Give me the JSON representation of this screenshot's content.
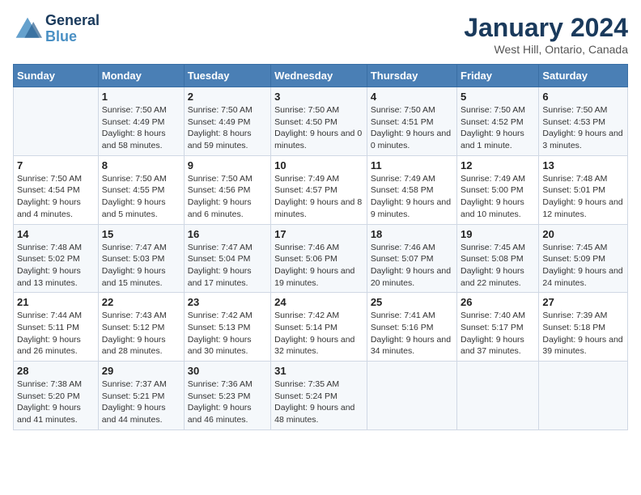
{
  "header": {
    "logo_line1": "General",
    "logo_line2": "Blue",
    "title": "January 2024",
    "subtitle": "West Hill, Ontario, Canada"
  },
  "weekdays": [
    "Sunday",
    "Monday",
    "Tuesday",
    "Wednesday",
    "Thursday",
    "Friday",
    "Saturday"
  ],
  "weeks": [
    [
      {
        "day": "",
        "sunrise": "",
        "sunset": "",
        "daylight": ""
      },
      {
        "day": "1",
        "sunrise": "Sunrise: 7:50 AM",
        "sunset": "Sunset: 4:49 PM",
        "daylight": "Daylight: 8 hours and 58 minutes."
      },
      {
        "day": "2",
        "sunrise": "Sunrise: 7:50 AM",
        "sunset": "Sunset: 4:49 PM",
        "daylight": "Daylight: 8 hours and 59 minutes."
      },
      {
        "day": "3",
        "sunrise": "Sunrise: 7:50 AM",
        "sunset": "Sunset: 4:50 PM",
        "daylight": "Daylight: 9 hours and 0 minutes."
      },
      {
        "day": "4",
        "sunrise": "Sunrise: 7:50 AM",
        "sunset": "Sunset: 4:51 PM",
        "daylight": "Daylight: 9 hours and 0 minutes."
      },
      {
        "day": "5",
        "sunrise": "Sunrise: 7:50 AM",
        "sunset": "Sunset: 4:52 PM",
        "daylight": "Daylight: 9 hours and 1 minute."
      },
      {
        "day": "6",
        "sunrise": "Sunrise: 7:50 AM",
        "sunset": "Sunset: 4:53 PM",
        "daylight": "Daylight: 9 hours and 3 minutes."
      }
    ],
    [
      {
        "day": "7",
        "sunrise": "Sunrise: 7:50 AM",
        "sunset": "Sunset: 4:54 PM",
        "daylight": "Daylight: 9 hours and 4 minutes."
      },
      {
        "day": "8",
        "sunrise": "Sunrise: 7:50 AM",
        "sunset": "Sunset: 4:55 PM",
        "daylight": "Daylight: 9 hours and 5 minutes."
      },
      {
        "day": "9",
        "sunrise": "Sunrise: 7:50 AM",
        "sunset": "Sunset: 4:56 PM",
        "daylight": "Daylight: 9 hours and 6 minutes."
      },
      {
        "day": "10",
        "sunrise": "Sunrise: 7:49 AM",
        "sunset": "Sunset: 4:57 PM",
        "daylight": "Daylight: 9 hours and 8 minutes."
      },
      {
        "day": "11",
        "sunrise": "Sunrise: 7:49 AM",
        "sunset": "Sunset: 4:58 PM",
        "daylight": "Daylight: 9 hours and 9 minutes."
      },
      {
        "day": "12",
        "sunrise": "Sunrise: 7:49 AM",
        "sunset": "Sunset: 5:00 PM",
        "daylight": "Daylight: 9 hours and 10 minutes."
      },
      {
        "day": "13",
        "sunrise": "Sunrise: 7:48 AM",
        "sunset": "Sunset: 5:01 PM",
        "daylight": "Daylight: 9 hours and 12 minutes."
      }
    ],
    [
      {
        "day": "14",
        "sunrise": "Sunrise: 7:48 AM",
        "sunset": "Sunset: 5:02 PM",
        "daylight": "Daylight: 9 hours and 13 minutes."
      },
      {
        "day": "15",
        "sunrise": "Sunrise: 7:47 AM",
        "sunset": "Sunset: 5:03 PM",
        "daylight": "Daylight: 9 hours and 15 minutes."
      },
      {
        "day": "16",
        "sunrise": "Sunrise: 7:47 AM",
        "sunset": "Sunset: 5:04 PM",
        "daylight": "Daylight: 9 hours and 17 minutes."
      },
      {
        "day": "17",
        "sunrise": "Sunrise: 7:46 AM",
        "sunset": "Sunset: 5:06 PM",
        "daylight": "Daylight: 9 hours and 19 minutes."
      },
      {
        "day": "18",
        "sunrise": "Sunrise: 7:46 AM",
        "sunset": "Sunset: 5:07 PM",
        "daylight": "Daylight: 9 hours and 20 minutes."
      },
      {
        "day": "19",
        "sunrise": "Sunrise: 7:45 AM",
        "sunset": "Sunset: 5:08 PM",
        "daylight": "Daylight: 9 hours and 22 minutes."
      },
      {
        "day": "20",
        "sunrise": "Sunrise: 7:45 AM",
        "sunset": "Sunset: 5:09 PM",
        "daylight": "Daylight: 9 hours and 24 minutes."
      }
    ],
    [
      {
        "day": "21",
        "sunrise": "Sunrise: 7:44 AM",
        "sunset": "Sunset: 5:11 PM",
        "daylight": "Daylight: 9 hours and 26 minutes."
      },
      {
        "day": "22",
        "sunrise": "Sunrise: 7:43 AM",
        "sunset": "Sunset: 5:12 PM",
        "daylight": "Daylight: 9 hours and 28 minutes."
      },
      {
        "day": "23",
        "sunrise": "Sunrise: 7:42 AM",
        "sunset": "Sunset: 5:13 PM",
        "daylight": "Daylight: 9 hours and 30 minutes."
      },
      {
        "day": "24",
        "sunrise": "Sunrise: 7:42 AM",
        "sunset": "Sunset: 5:14 PM",
        "daylight": "Daylight: 9 hours and 32 minutes."
      },
      {
        "day": "25",
        "sunrise": "Sunrise: 7:41 AM",
        "sunset": "Sunset: 5:16 PM",
        "daylight": "Daylight: 9 hours and 34 minutes."
      },
      {
        "day": "26",
        "sunrise": "Sunrise: 7:40 AM",
        "sunset": "Sunset: 5:17 PM",
        "daylight": "Daylight: 9 hours and 37 minutes."
      },
      {
        "day": "27",
        "sunrise": "Sunrise: 7:39 AM",
        "sunset": "Sunset: 5:18 PM",
        "daylight": "Daylight: 9 hours and 39 minutes."
      }
    ],
    [
      {
        "day": "28",
        "sunrise": "Sunrise: 7:38 AM",
        "sunset": "Sunset: 5:20 PM",
        "daylight": "Daylight: 9 hours and 41 minutes."
      },
      {
        "day": "29",
        "sunrise": "Sunrise: 7:37 AM",
        "sunset": "Sunset: 5:21 PM",
        "daylight": "Daylight: 9 hours and 44 minutes."
      },
      {
        "day": "30",
        "sunrise": "Sunrise: 7:36 AM",
        "sunset": "Sunset: 5:23 PM",
        "daylight": "Daylight: 9 hours and 46 minutes."
      },
      {
        "day": "31",
        "sunrise": "Sunrise: 7:35 AM",
        "sunset": "Sunset: 5:24 PM",
        "daylight": "Daylight: 9 hours and 48 minutes."
      },
      {
        "day": "",
        "sunrise": "",
        "sunset": "",
        "daylight": ""
      },
      {
        "day": "",
        "sunrise": "",
        "sunset": "",
        "daylight": ""
      },
      {
        "day": "",
        "sunrise": "",
        "sunset": "",
        "daylight": ""
      }
    ]
  ]
}
